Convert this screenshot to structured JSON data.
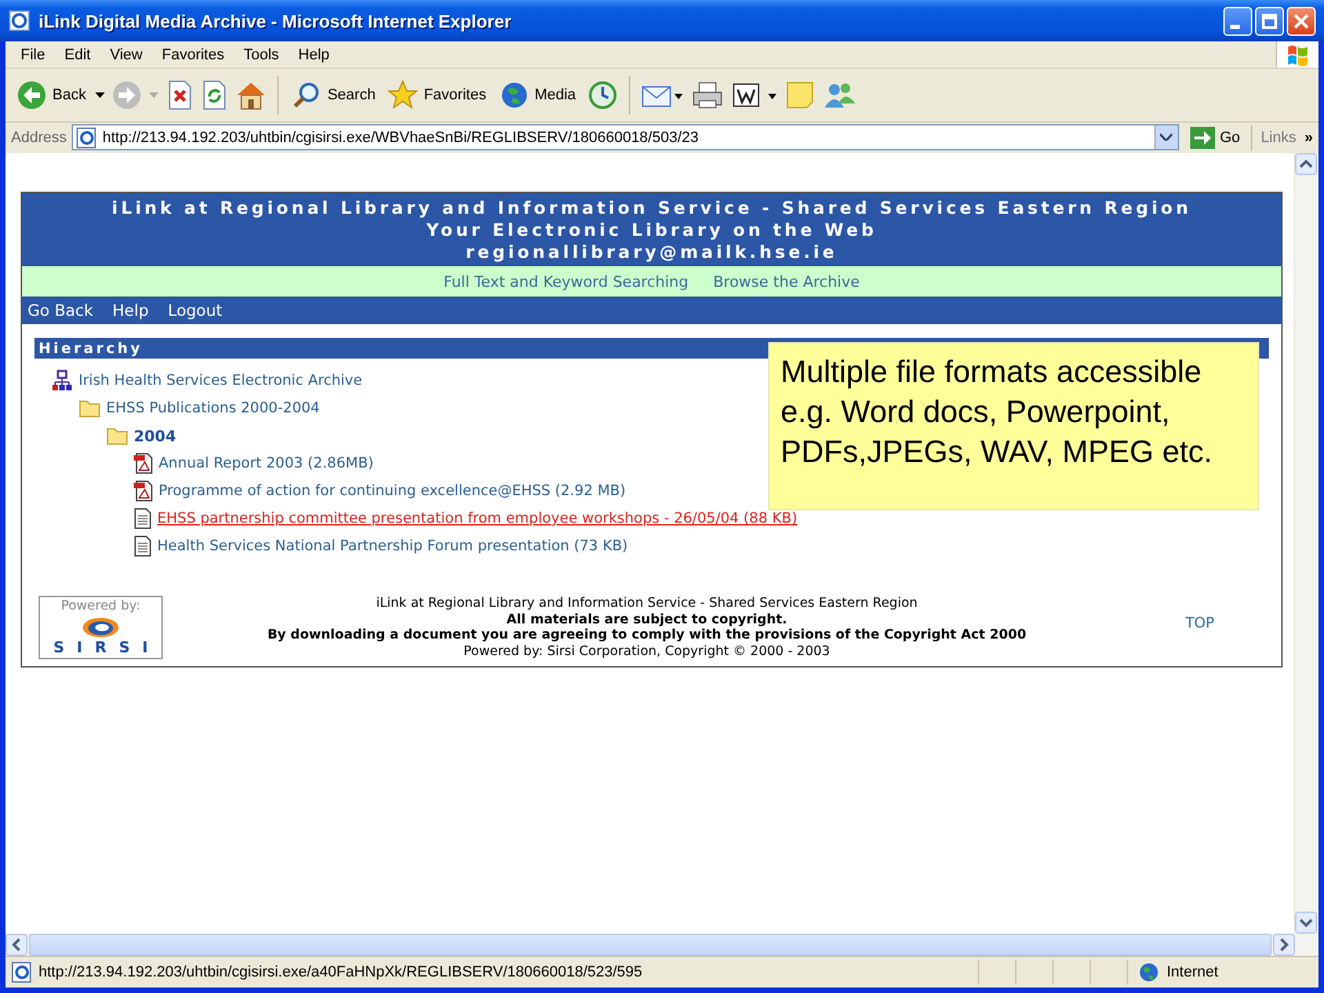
{
  "window": {
    "title": "iLink Digital Media Archive - Microsoft Internet Explorer"
  },
  "menu_bar": [
    "File",
    "Edit",
    "View",
    "Favorites",
    "Tools",
    "Help"
  ],
  "toolbar": {
    "back": "Back",
    "search": "Search",
    "favorites": "Favorites",
    "media": "Media"
  },
  "address_bar": {
    "label": "Address",
    "url": "http://213.94.192.203/uhtbin/cgisirsi.exe/WBVhaeSnBi/REGLIBSERV/180660018/503/23",
    "go": "Go",
    "links": "Links",
    "chevron": "»"
  },
  "page": {
    "header_lines": [
      "iLink at Regional Library and Information Service - Shared Services Eastern Region",
      "Your Electronic Library on the Web",
      "regionallibrary@mailk.hse.ie"
    ],
    "search_links": [
      "Full Text and Keyword Searching",
      "Browse the Archive"
    ],
    "nav_links": [
      "Go Back",
      "Help",
      "Logout"
    ],
    "hierarchy": {
      "title": "Hierarchy",
      "tree": [
        {
          "label": "Irish Health Services Electronic Archive",
          "kind": "archive",
          "children": [
            {
              "label": "EHSS Publications 2000-2004",
              "kind": "folder",
              "current": false,
              "children": [
                {
                  "label": "2004",
                  "kind": "folder",
                  "current": true,
                  "children": [
                    {
                      "label": "Annual Report 2003 (2.86MB)",
                      "kind": "pdf",
                      "selected": false
                    },
                    {
                      "label": "Programme of action for continuing excellence@EHSS (2.92 MB)",
                      "kind": "pdf",
                      "selected": false
                    },
                    {
                      "label": "EHSS partnership committee presentation from employee workshops - 26/05/04 (88 KB)",
                      "kind": "doc",
                      "selected": true
                    },
                    {
                      "label": "Health Services National Partnership Forum presentation (73 KB)",
                      "kind": "doc",
                      "selected": false
                    }
                  ]
                }
              ]
            }
          ]
        }
      ]
    },
    "callout": "Multiple file formats accessible e.g. Word docs, Powerpoint, PDFs,JPEGs, WAV, MPEG etc.",
    "footer": {
      "logo_caption": "Powered by:",
      "logo_text": "SIRSI",
      "lines": [
        {
          "text": "iLink at Regional Library and Information Service - Shared Services Eastern Region",
          "bold": false
        },
        {
          "text": "All materials are subject to copyright.",
          "bold": true
        },
        {
          "text": "By downloading a document you are agreeing to comply with the provisions of the Copyright Act 2000",
          "bold": true
        },
        {
          "text": "Powered by: Sirsi Corporation, Copyright © 2000 - 2003",
          "bold": false
        }
      ],
      "top": "TOP"
    }
  },
  "status_bar": {
    "url": "http://213.94.192.203/uhtbin/cgisirsi.exe/a40FaHNpXk/REGLIBSERV/180660018/523/595",
    "zone": "Internet"
  }
}
